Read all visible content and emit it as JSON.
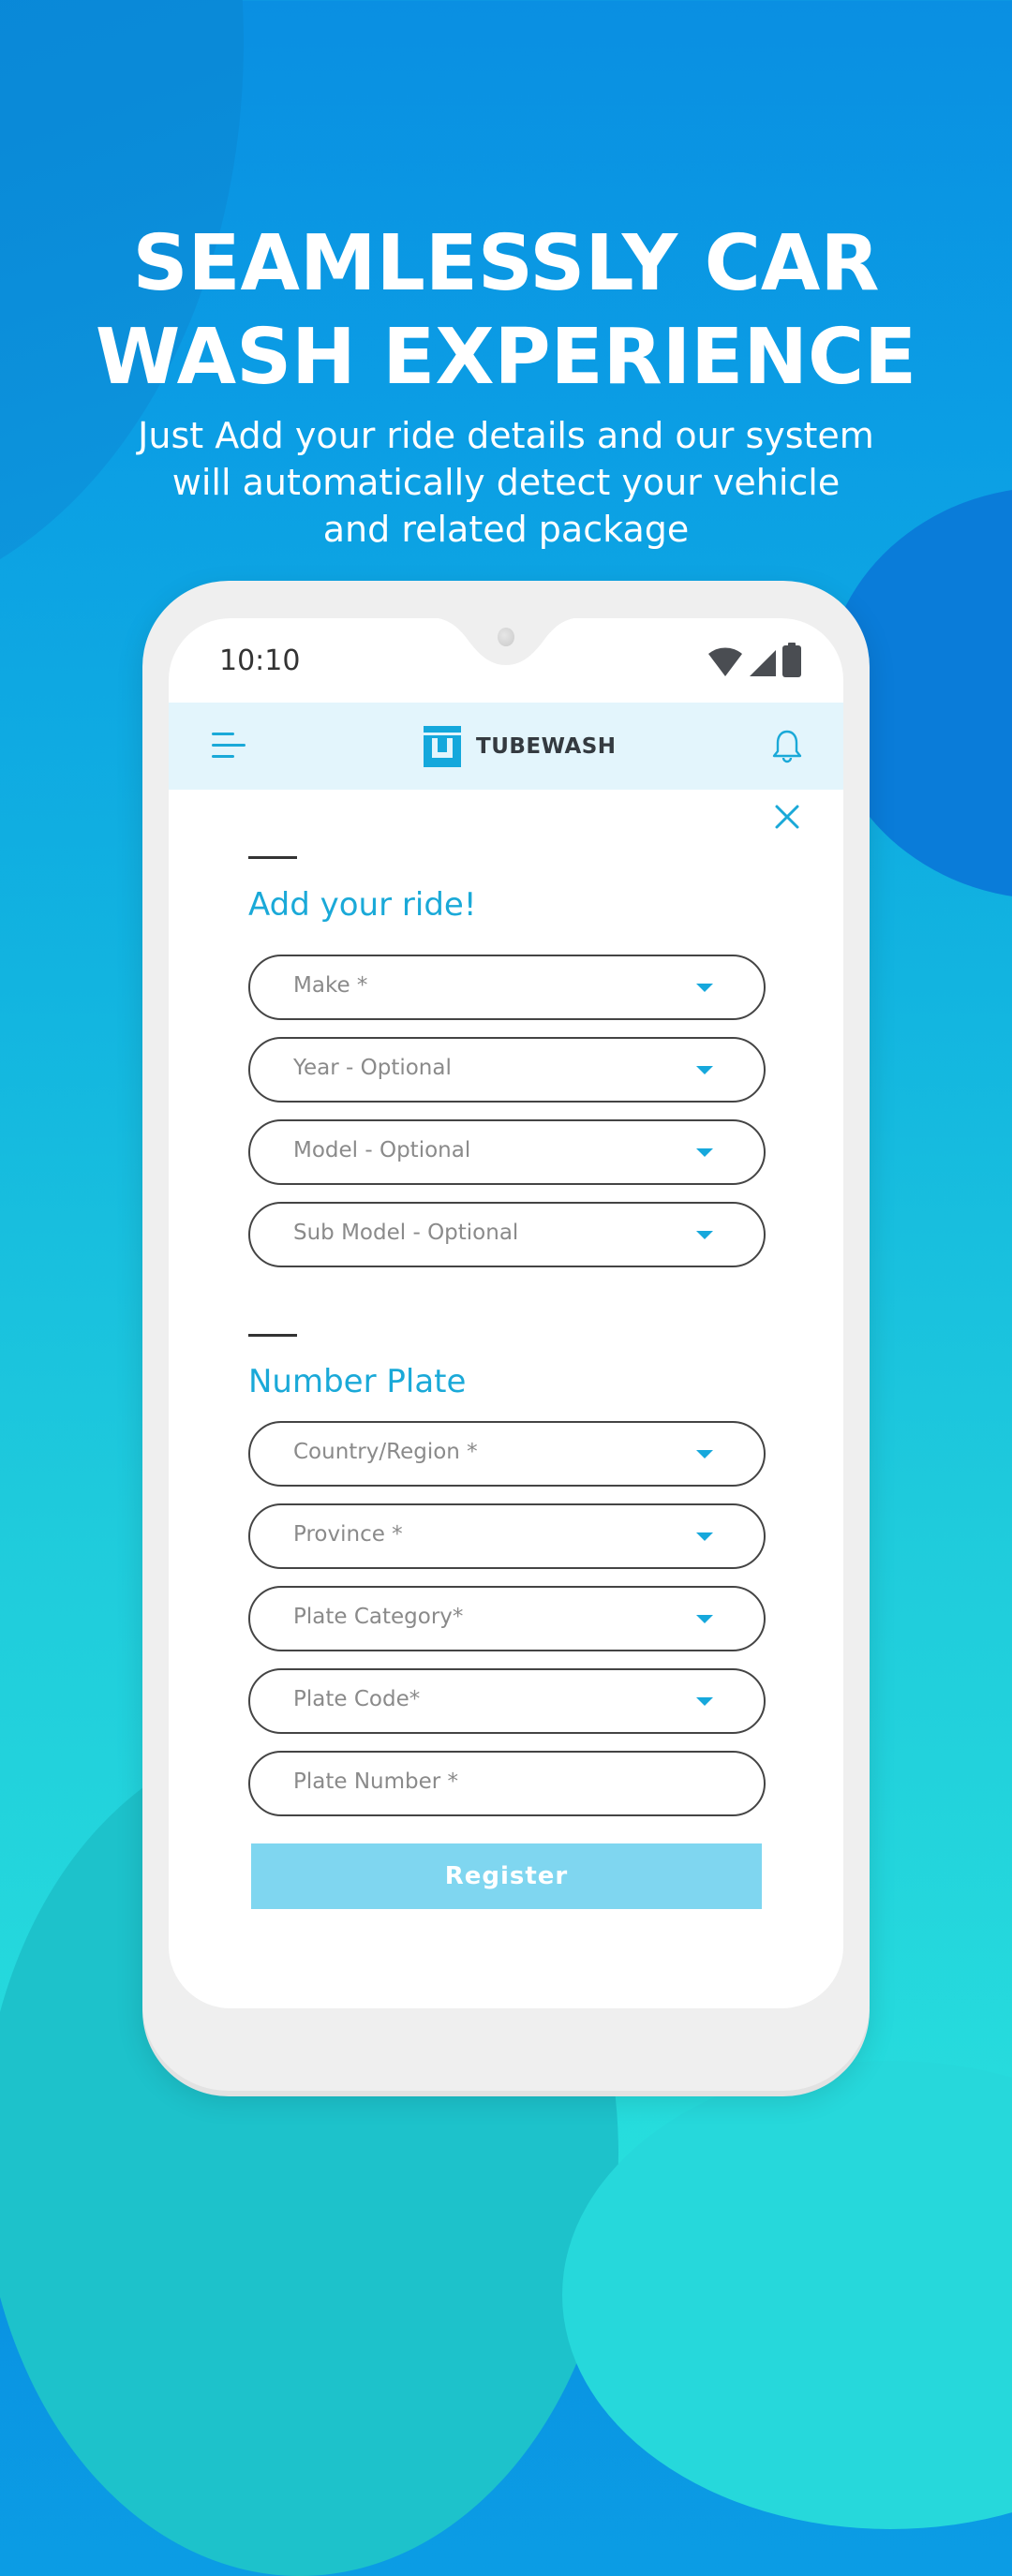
{
  "promo": {
    "headline_lines": [
      "SEAMLESSLY CAR",
      "WASH EXPERIENCE"
    ],
    "subtitle_lines": [
      "Just Add your ride details and our system",
      "will automatically detect your vehicle",
      "and related package"
    ]
  },
  "status_bar": {
    "time": "10:10",
    "icons": [
      "wifi-icon",
      "signal-icon",
      "battery-icon"
    ]
  },
  "app_header": {
    "brand": "TUBEWASH",
    "left_icon": "menu-icon",
    "right_icon": "bell-icon"
  },
  "form": {
    "close_icon": "close-icon",
    "ride_section": {
      "title": "Add your ride!",
      "fields": [
        {
          "label": "Make *",
          "type": "dropdown"
        },
        {
          "label": "Year - Optional",
          "type": "dropdown"
        },
        {
          "label": "Model - Optional",
          "type": "dropdown"
        },
        {
          "label": "Sub Model - Optional",
          "type": "dropdown"
        }
      ]
    },
    "plate_section": {
      "title": "Number Plate",
      "fields": [
        {
          "label": "Country/Region *",
          "type": "dropdown"
        },
        {
          "label": "Province *",
          "type": "dropdown"
        },
        {
          "label": "Plate Category*",
          "type": "dropdown"
        },
        {
          "label": "Plate Code*",
          "type": "dropdown"
        },
        {
          "label": "Plate Number *",
          "type": "text"
        }
      ]
    },
    "submit_label": "Register"
  },
  "colors": {
    "accent": "#1aa9d8",
    "header_bg": "#e3f5fc",
    "button_bg": "#7fd6f0",
    "field_border": "#444444",
    "placeholder": "#8a8a8a"
  }
}
